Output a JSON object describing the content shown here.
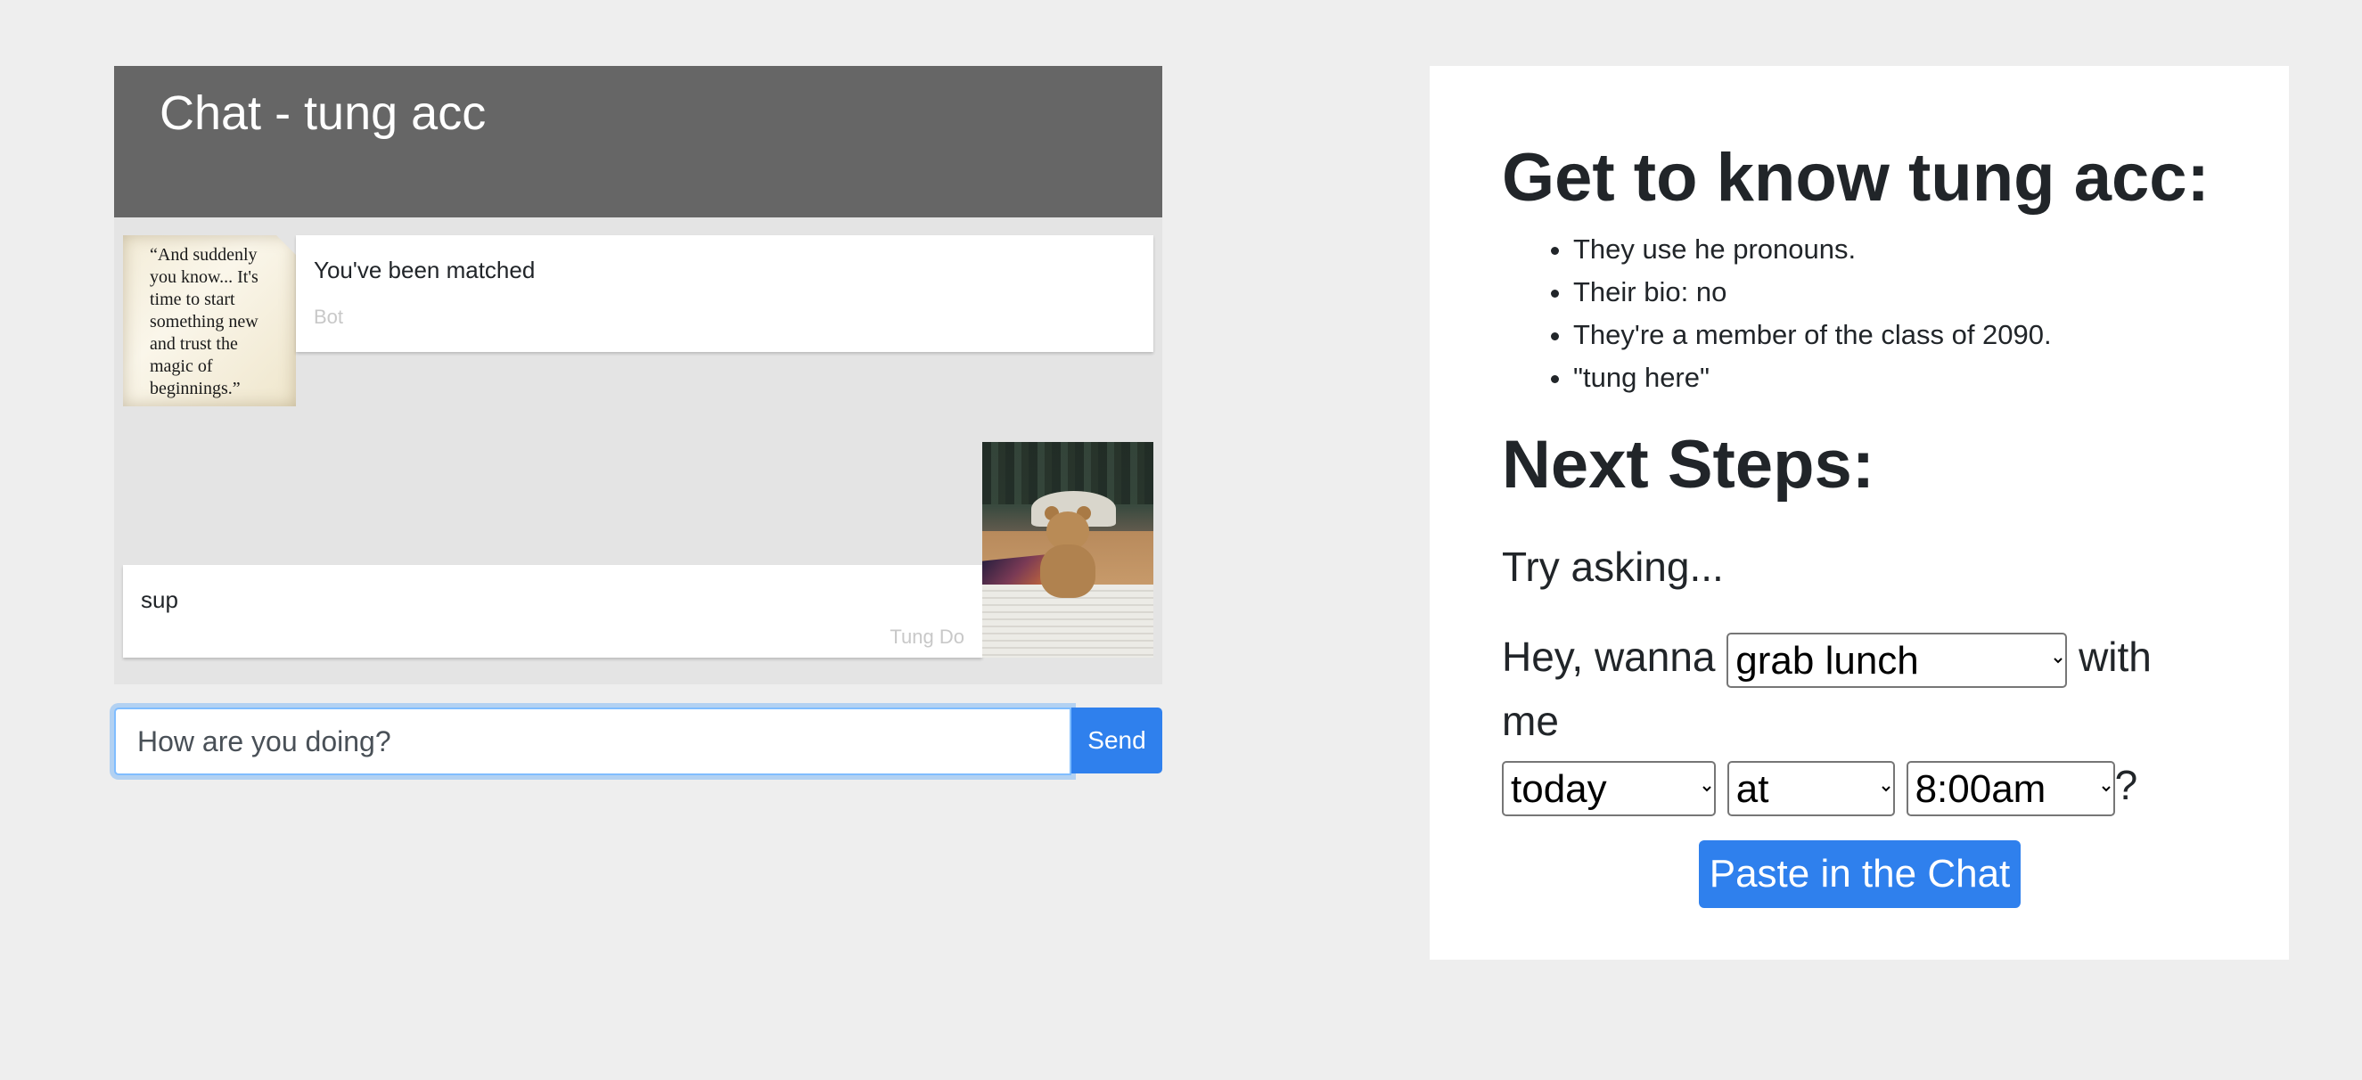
{
  "chat": {
    "title": "Chat - tung acc",
    "messages": [
      {
        "text": "You've been matched",
        "sender": "Bot",
        "avatar_quote": "“And suddenly you know... It's time to start something new and trust the magic of beginnings.”"
      },
      {
        "text": "sup",
        "sender": "Tung Do",
        "avatar": "teddy-bear-photo"
      }
    ],
    "input_value": "How are you doing?",
    "send_label": "Send"
  },
  "info": {
    "title": "Get to know tung acc:",
    "facts": [
      "They use he pronouns.",
      "Their bio: no",
      "They're a member of the class of 2090.",
      "\"tung here\""
    ],
    "next_title": "Next Steps:",
    "try_label": "Try asking...",
    "prompt": {
      "prefix": "Hey, wanna",
      "activity": "grab lunch",
      "middle": "with me",
      "day": "today",
      "at": "at",
      "time": "8:00am",
      "suffix": "?"
    },
    "paste_label": "Paste in the Chat"
  },
  "colors": {
    "header_bg": "#666666",
    "accent": "#2f80ed",
    "page_bg": "#eeeeee"
  }
}
